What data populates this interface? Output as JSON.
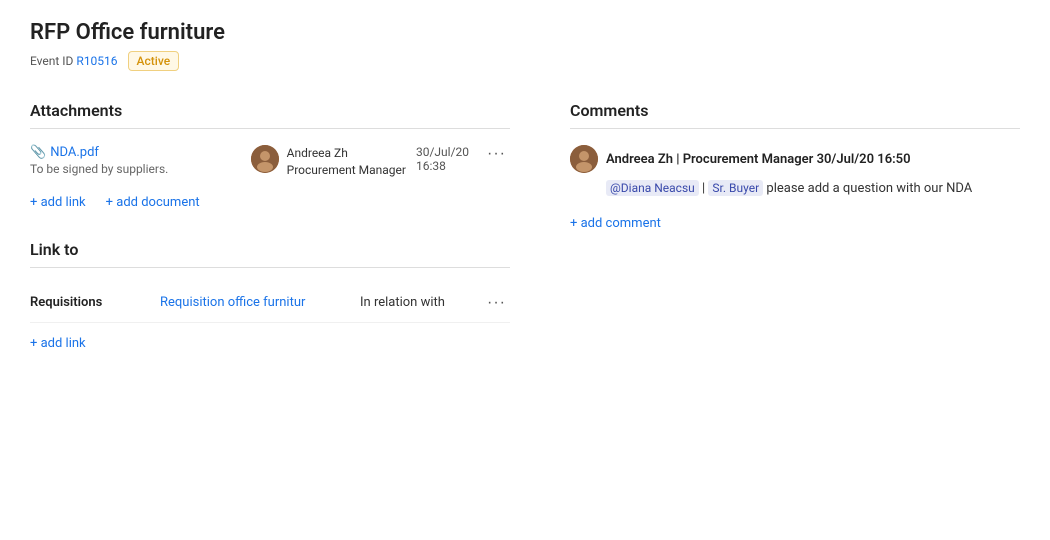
{
  "header": {
    "title": "RFP Office furniture",
    "event_label": "Event ID",
    "event_id": "R10516",
    "status": "Active"
  },
  "attachments": {
    "section_title": "Attachments",
    "items": [
      {
        "name": "NDA.pdf",
        "description": "To be signed by suppliers.",
        "user_name": "Andreea Zh",
        "user_role": "Procurement Manager",
        "date": "30/Jul/20",
        "time": "16:38"
      }
    ],
    "add_link": "+ add link",
    "add_document": "+ add document"
  },
  "comments": {
    "section_title": "Comments",
    "items": [
      {
        "author": "Andreea Zh",
        "role": "Procurement Manager",
        "datetime": "30/Jul/20 16:50",
        "mention1": "@Diana Neacsu",
        "separator": " | ",
        "mention2": "Sr. Buyer",
        "body_text": " please add a question with our NDA"
      }
    ],
    "add_comment": "+ add comment"
  },
  "link_to": {
    "section_title": "Link to",
    "table": {
      "col_type": "Requisitions",
      "col_name": "Requisition office furnitur",
      "col_relation": "In relation with"
    },
    "add_link": "+ add link"
  },
  "icons": {
    "paperclip": "📎",
    "ellipsis": "···"
  }
}
